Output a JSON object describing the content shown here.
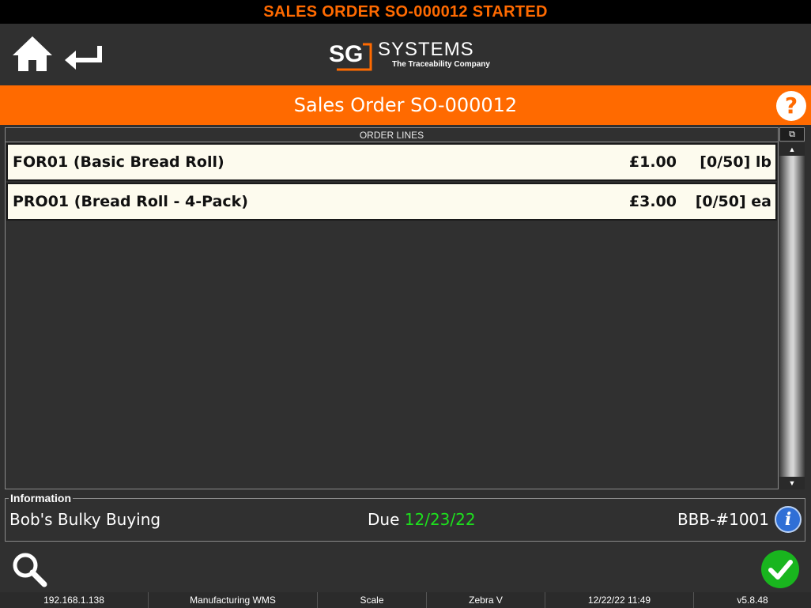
{
  "status_bar": {
    "text": "SALES ORDER SO-000012 STARTED"
  },
  "header": {
    "logo_mark": "SG",
    "logo_name": "SYSTEMS",
    "logo_tagline": "The Traceability Company"
  },
  "title_bar": {
    "title": "Sales Order SO-000012",
    "help_glyph": "?"
  },
  "order_lines": {
    "header": "ORDER LINES",
    "lines": [
      {
        "name": "FOR01 (Basic Bread Roll)",
        "price": "£1.00",
        "qty": "[0/50] lb"
      },
      {
        "name": "PRO01 (Bread Roll - 4-Pack)",
        "price": "£3.00",
        "qty": "[0/50] ea"
      }
    ]
  },
  "information": {
    "legend": "Information",
    "customer": "Bob's Bulky Buying",
    "due_label": "Due",
    "due_date": "12/23/22",
    "reference": "BBB-#1001",
    "info_glyph": "i"
  },
  "footer": {
    "ip": "192.168.1.138",
    "app": "Manufacturing WMS",
    "device": "Scale",
    "printer": "Zebra V",
    "datetime": "12/22/22 11:49",
    "version": "v5.8.48"
  },
  "colors": {
    "accent": "#ff6a00",
    "confirm": "#19b51e",
    "due_date": "#1de01d",
    "info": "#2f6fd6"
  },
  "icons": [
    "home-icon",
    "back-arrow-icon",
    "help-icon",
    "info-icon",
    "search-icon",
    "checkmark-icon",
    "scroll-up-icon",
    "scroll-down-icon",
    "corner-menu-icon"
  ]
}
